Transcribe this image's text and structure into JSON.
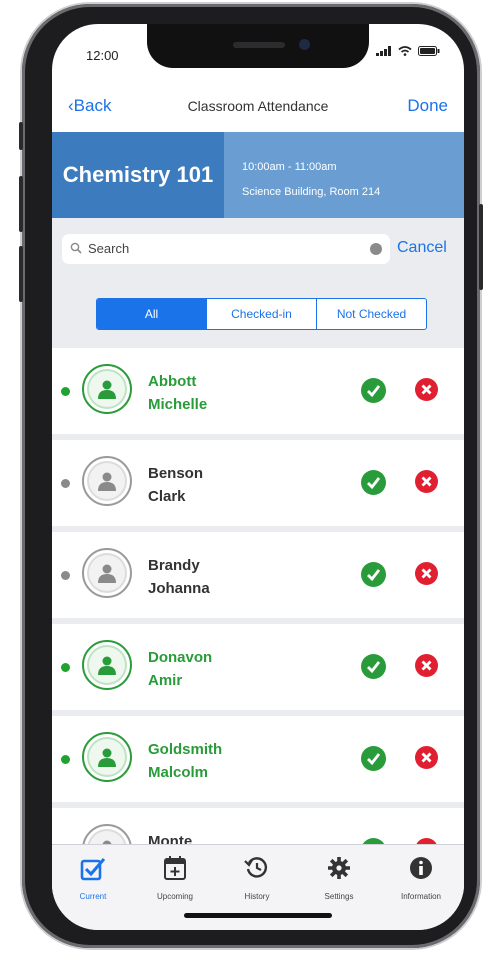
{
  "colors": {
    "accent": "#1a73e8",
    "green": "#2a9b3a",
    "red": "#e02030",
    "header_dark": "#3d7bbf",
    "header_light": "#6a9ed3",
    "present_dot": "#1fa22e",
    "absent_dot": "#8a8a8a"
  },
  "status_bar": {
    "time": "12:00"
  },
  "nav": {
    "back_label": "Back",
    "title": "Classroom Attendance",
    "done_label": "Done"
  },
  "course": {
    "name": "Chemistry 101",
    "time": "10:00am - 11:00am",
    "location": "Science Building, Room 214"
  },
  "search": {
    "placeholder": "Search",
    "cancel_label": "Cancel"
  },
  "filters": [
    "All",
    "Checked-in",
    "Not Checked"
  ],
  "students": [
    {
      "last": "Abbott",
      "first": "Michelle",
      "checked_in": true
    },
    {
      "last": "Benson",
      "first": "Clark",
      "checked_in": false
    },
    {
      "last": "Brandy",
      "first": "Johanna",
      "checked_in": false
    },
    {
      "last": "Donavon",
      "first": "Amir",
      "checked_in": true
    },
    {
      "last": "Goldsmith",
      "first": "Malcolm",
      "checked_in": true
    },
    {
      "last": "Monte",
      "first": "",
      "checked_in": false
    }
  ],
  "tabs": [
    {
      "label": "Current",
      "icon": "checkbox-icon",
      "active": true
    },
    {
      "label": "Upcoming",
      "icon": "calendar-add-icon",
      "active": false
    },
    {
      "label": "History",
      "icon": "history-icon",
      "active": false
    },
    {
      "label": "Settings",
      "icon": "gear-icon",
      "active": false
    },
    {
      "label": "Information",
      "icon": "info-icon",
      "active": false
    }
  ]
}
